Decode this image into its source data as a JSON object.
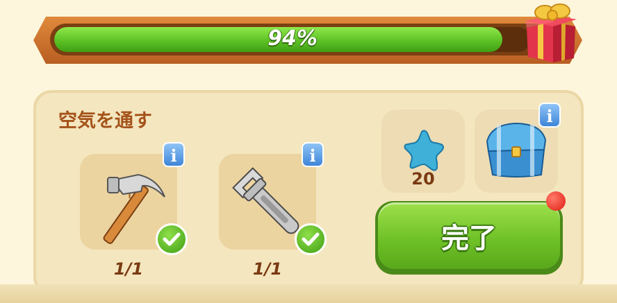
{
  "progress": {
    "percent_label": "94%",
    "fraction": 0.94
  },
  "quest": {
    "title": "空気を通す"
  },
  "requirements": [
    {
      "icon": "hammer-icon",
      "count": "1/1",
      "completed": true
    },
    {
      "icon": "wrench-icon",
      "count": "1/1",
      "completed": true
    }
  ],
  "rewards": [
    {
      "icon": "blue-star-icon",
      "amount": "20"
    },
    {
      "icon": "treasure-chest-icon"
    }
  ],
  "actions": {
    "complete_label": "完了"
  },
  "colors": {
    "progress_green": "#5dc225",
    "frame_orange": "#c86a2a",
    "panel_bg": "#f4e6bf",
    "title_brown": "#a4531a",
    "info_blue": "#3f85d8",
    "complete_green": "#6cbf25",
    "notification_red": "#e01c12"
  }
}
